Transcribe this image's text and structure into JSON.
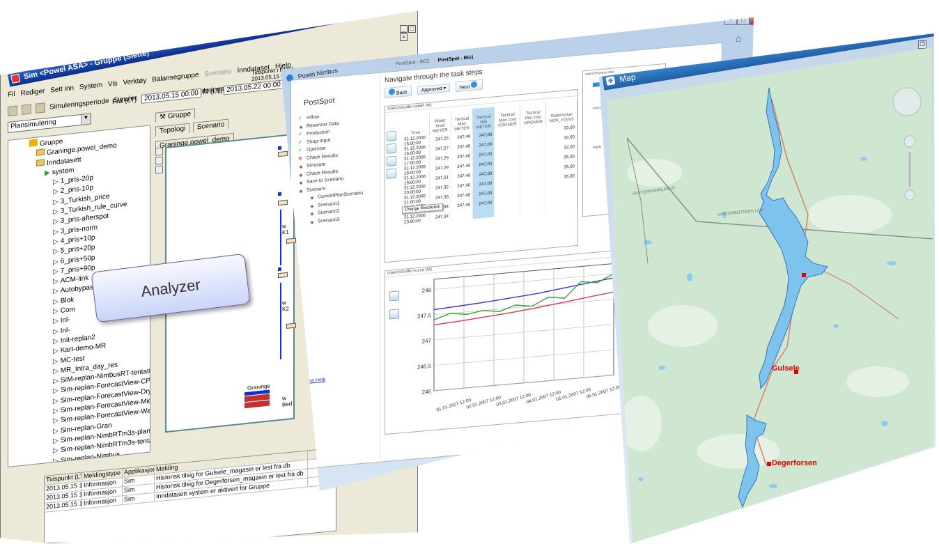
{
  "sim": {
    "title": "Sim <Powel ASA> - Gruppe (Slette)",
    "menu": [
      "Fil",
      "Rediger",
      "Sett inn",
      "System",
      "Vis",
      "Verktøy",
      "Balansegruppe",
      "Scenario",
      "Inndataset",
      "Hjelp"
    ],
    "toolbar": {
      "period": "Simuleringsperiode",
      "simulate": "Simuler",
      "historic": "Historisk tilsig",
      "result": "Simuleringsresultat",
      "from_label": "Fra (LT)",
      "from_value": "2013.05.15 00:00",
      "to_label": "Til (LT)",
      "to_value": "2013.05.22 00:00",
      "timepoint": "Tidspunkt i bildet",
      "timepoint_value": "2013.05.15 00:00"
    },
    "mode_select": "Plansimulering",
    "tree": {
      "root": "Gruppe",
      "children": [
        "Graninge.powel_demo",
        "Inndatasett"
      ],
      "system": "system",
      "items": [
        "1_pris-20p",
        "2_pris-10p",
        "3_Turkish_price",
        "3_Turkish_rule_curve",
        "3_pris-afterspot",
        "3_pris-norm",
        "4_pris+10p",
        "5_pris+20p",
        "6_pris+50p",
        "7_pris+90p",
        "ACM-link",
        "Autobypass",
        "Blok",
        "Com",
        "Inl-",
        "Inl-",
        "Init-replan2",
        "Kart-demo-MR",
        "MC-test",
        "MR_Intra_day_res",
        "SIM-replan-NimbusRT-tentative",
        "Sim-replan-ForecastView-CPS_I",
        "Sim-replan-ForecastView-Dry",
        "Sim-replan-ForecastView-Mid",
        "Sim-replan-ForecastView-Wet",
        "Sim-replan-Gran",
        "Sim-replan-NimbRTm3s-planMi",
        "Sim-replan-NimbRTm3s-tentativ",
        "Sim-replan-Nimbus",
        "Sim-replan-NimbusRT"
      ]
    },
    "right_tabs": {
      "group_tab": "Gruppe",
      "topology": "Topologi",
      "scenario": "Scenario",
      "doc_tab": "Graninge.powel_demo"
    },
    "diagram_labels": [
      "w K1",
      "w K2",
      "w Bed",
      "Graninge"
    ],
    "log": {
      "headers": [
        "Tidspunkt (LT)",
        "Meldingstype",
        "Applikasjon",
        "Melding"
      ],
      "rows": [
        [
          "2013.05.15 1",
          "Informasjon",
          "Sim",
          "Historisk tilsig for Gulsele_magasin er lest fra db"
        ],
        [
          "2013.05.15 1",
          "Informasjon",
          "Sim",
          "Historisk tilsig for Degerforsen_magasin er lest fra db"
        ],
        [
          "2013.05.15 1",
          "Informasjon",
          "Sim",
          "Inndatasett system er aktivert for Gruppe"
        ]
      ]
    }
  },
  "analyzer_label": "Analyzer",
  "nimbus": {
    "title": "Powel Nimbus",
    "tabs": [
      "PostSpot - BG2",
      "PostSpot - BG1"
    ],
    "sidebar_title": "PostSpot",
    "steps": [
      {
        "label": "Inflow",
        "state": "done"
      },
      {
        "label": "Reservoir Data",
        "state": "dot"
      },
      {
        "label": "Production",
        "state": "done"
      },
      {
        "label": "Shop-Input",
        "state": "done"
      },
      {
        "label": "Optimise",
        "state": "done"
      },
      {
        "label": "Check Results",
        "state": "error"
      },
      {
        "label": "Simulate",
        "state": "dot"
      },
      {
        "label": "Check Results",
        "state": "dot"
      },
      {
        "label": "Save to Scenario",
        "state": "dot"
      },
      {
        "label": "Scenario",
        "state": "dot"
      }
    ],
    "scenarios": [
      "CurrentPlanScenario",
      "Scenario1",
      "Scenario2",
      "Scenario3"
    ],
    "help_link": "View Help",
    "nav_title": "Navigate through the task steps",
    "back": "Back",
    "approved": "Approved",
    "next": "Next",
    "table_panel_title": "/stem/n/buffer-tabell (M)",
    "table_headers": [
      "Time",
      "Water level METER",
      "Tactical Max METER",
      "Tactical Min METER",
      "Tactical Max cost KRONER",
      "Tactical Min cost KRONER",
      "Watervalue NOK_m3/s/s"
    ],
    "table_rows": [
      [
        "31.12.2006 15:00:00",
        "247,25",
        "247,40",
        "247,00",
        "",
        "",
        "32,00"
      ],
      [
        "31.12.2006 16:00:00",
        "247,27",
        "247,40",
        "247,00",
        "",
        "",
        "32,00"
      ],
      [
        "31.12.2006 17:00:00",
        "247,28",
        "247,40",
        "247,00",
        "",
        "",
        "32,00"
      ],
      [
        "31.12.2006 18:00:00",
        "247,29",
        "247,40",
        "247,00",
        "",
        "",
        "35,00"
      ],
      [
        "31.12.2006 19:00:00",
        "247,31",
        "247,40",
        "247,00",
        "",
        "",
        "35,00"
      ],
      [
        "31.12.2006 20:00:00",
        "247,32",
        "247,40",
        "247,00",
        "",
        "",
        "35,00"
      ],
      [
        "31.12.2006 21:00:00",
        "247,33",
        "247,40",
        "247,00",
        "",
        "",
        ""
      ],
      [
        "31.12.2006 22:00:00",
        "247,34",
        "247,40",
        "247,00",
        "",
        "",
        ""
      ],
      [
        "31.12.2006 23:00:00",
        "247,34",
        "",
        "",
        "",
        "",
        ""
      ]
    ],
    "resolution_tip": "Change Resolution",
    "chart_panel_title": "/stem/n/buffer-kurve (M)",
    "right_panel_title": "/stem/Prosess-oke",
    "right_panel_items": [
      "Intens",
      "Apply"
    ]
  },
  "chart_data": {
    "type": "line",
    "title": "",
    "xlabel": "",
    "ylabel": "",
    "ylim": [
      246,
      248.2
    ],
    "yticks": [
      "246",
      "246.5",
      "247",
      "247.5",
      "248"
    ],
    "x": [
      "01.01.2007 12:00",
      "02.01.2007 12:00",
      "03.01.2007 12:00",
      "04.01.2007 12:00",
      "05.01.2007 12:00",
      "06.01.2007 12:00"
    ],
    "series": [
      {
        "values": [
          247.6,
          247.63,
          247.66,
          247.7,
          247.74,
          247.8,
          247.86,
          247.92
        ],
        "color": "#3030e0"
      },
      {
        "values": [
          247.3,
          247.33,
          247.37,
          247.41,
          247.46,
          247.52,
          247.58,
          247.64
        ],
        "color": "#e0305a"
      },
      {
        "values": [
          247.4,
          247.5,
          247.45,
          247.5,
          247.45,
          247.55,
          247.5,
          247.65,
          247.6,
          247.9,
          247.85,
          248.0
        ],
        "color": "#30a030"
      }
    ],
    "grid": true
  },
  "map": {
    "title": "Map",
    "labels": [
      "Gulsele",
      "Degerforsen",
      "VÄSTERNORRLANDS",
      "VÄSTERBOTTENS LÄN"
    ],
    "colors": {
      "land": "#cfe6d0",
      "water": "#7ec3ee",
      "road": "#d9806a",
      "marker": "#e00000"
    }
  }
}
